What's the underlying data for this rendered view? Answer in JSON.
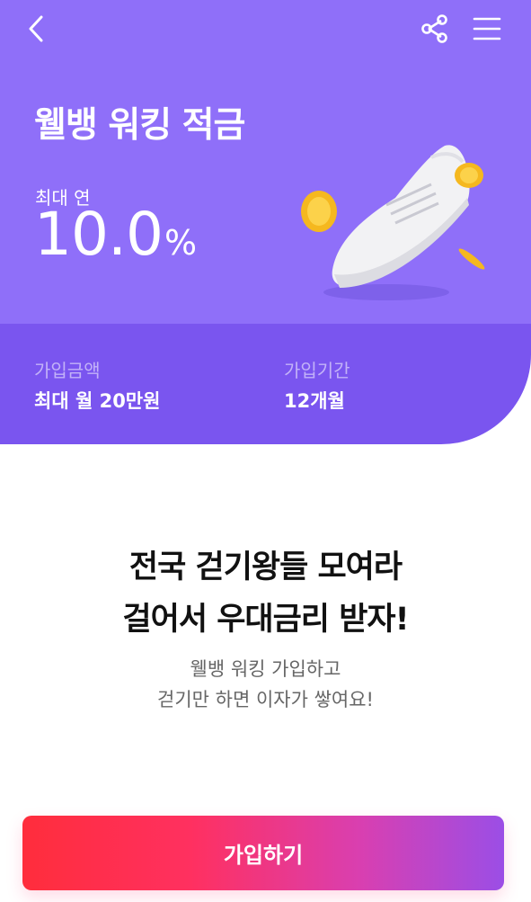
{
  "header": {
    "title": "웰뱅 워킹 적금",
    "rate_label": "최대 연",
    "rate_value": "10.0",
    "rate_unit": "%"
  },
  "info": {
    "amount_label": "가입금액",
    "amount_value": "최대 월 20만원",
    "period_label": "가입기간",
    "period_value": "12개월"
  },
  "promo": {
    "headline_1": "전국 걷기왕들 모여라",
    "headline_2": "걸어서 우대금리 받자!",
    "sub_1": "웰뱅 워킹 가입하고",
    "sub_2": "걷기만 하면 이자가 쌓여요!"
  },
  "cta": {
    "label": "가입하기"
  },
  "colors": {
    "hero": "#8f6ff9",
    "band": "#7a55ef",
    "cta_start": "#ff2d3c",
    "cta_end": "#9b4ee6"
  },
  "icons": [
    "back-arrow-icon",
    "share-icon",
    "menu-icon",
    "shoe-illustration",
    "coin-icon"
  ]
}
